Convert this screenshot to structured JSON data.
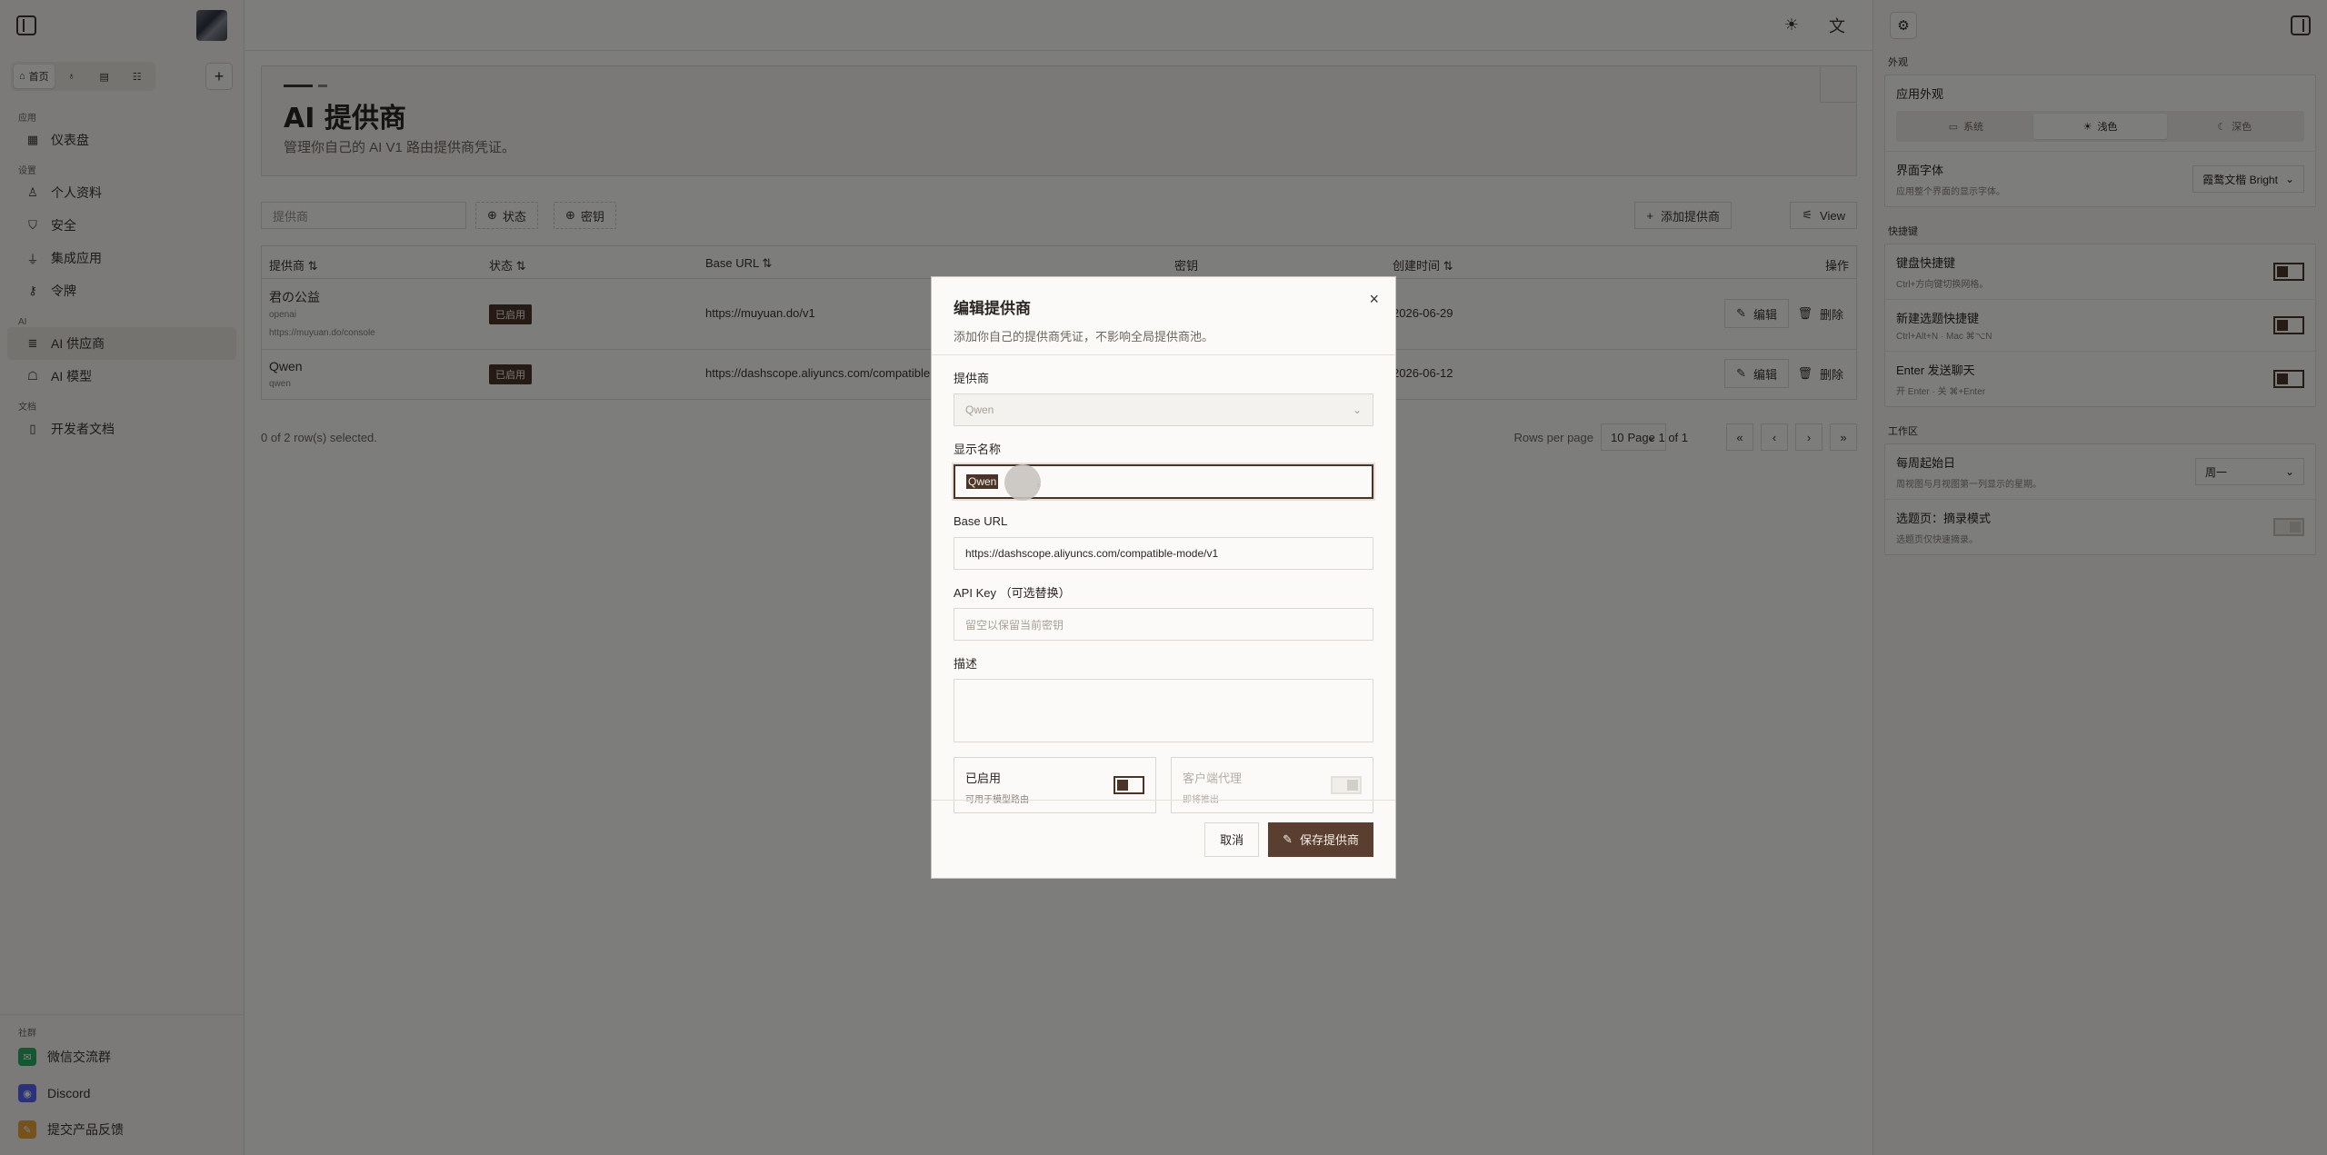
{
  "sidebar": {
    "tabs": [
      {
        "label": "首页",
        "icon": "home-icon"
      },
      {
        "label": "",
        "icon": "lightbulb-icon"
      },
      {
        "label": "",
        "icon": "book-icon"
      },
      {
        "label": "",
        "icon": "chat-icon"
      }
    ],
    "groups": {
      "apps": "应用",
      "settings": "设置",
      "ai": "AI",
      "docs": "文档",
      "community": "社群"
    },
    "items": {
      "dashboard": "仪表盘",
      "profile": "个人资料",
      "security": "安全",
      "integrations": "集成应用",
      "tokens": "令牌",
      "ai_providers": "AI 供应商",
      "ai_models": "AI 模型",
      "dev_docs": "开发者文档"
    },
    "community": {
      "wechat": "微信交流群",
      "discord": "Discord",
      "feedback": "提交产品反馈"
    }
  },
  "page": {
    "title": "AI 提供商",
    "subtitle": "管理你自己的 AI V1 路由提供商凭证。"
  },
  "toolbar": {
    "search_placeholder": "提供商",
    "filter_status": "状态",
    "filter_key": "密钥",
    "add_provider": "添加提供商",
    "view": "View"
  },
  "table": {
    "headers": {
      "provider": "提供商",
      "status": "状态",
      "base_url": "Base URL",
      "key": "密钥",
      "created": "创建时间",
      "actions": "操作"
    },
    "rows": [
      {
        "name": "君の公益",
        "type": "openai",
        "link": "https://muyuan.do/console",
        "status": "已启用",
        "base_url": "https://muyuan.do/v1",
        "created": "2026-06-29",
        "edit": "编辑",
        "delete": "删除"
      },
      {
        "name": "Qwen",
        "type": "qwen",
        "link": "",
        "status": "已启用",
        "base_url": "https://dashscope.aliyuncs.com/compatible",
        "created": "2026-06-12",
        "edit": "编辑",
        "delete": "删除"
      }
    ],
    "selected_text": "0 of 2 row(s) selected.",
    "rows_per_page_label": "Rows per page",
    "rows_per_page": "10",
    "page_info": "Page 1 of 1"
  },
  "rpanel": {
    "appearance_section": "外观",
    "app_appearance": "应用外观",
    "theme_options": [
      {
        "label": "系统",
        "icon": "monitor-icon",
        "active": false
      },
      {
        "label": "浅色",
        "icon": "sun-icon",
        "active": true
      },
      {
        "label": "深色",
        "icon": "moon-icon",
        "active": false
      }
    ],
    "font_title": "界面字体",
    "font_sub": "应用整个界面的显示字体。",
    "font_value": "霞鹜文楷 Bright",
    "shortcuts_section": "快捷键",
    "shortcuts": [
      {
        "title": "键盘快捷键",
        "sub": "Ctrl+方向键切换网格。",
        "on": true
      },
      {
        "title": "新建选题快捷键",
        "sub": "Ctrl+Alt+N · Mac ⌘⌥N",
        "on": true
      },
      {
        "title": "Enter 发送聊天",
        "sub": "开 Enter · 关 ⌘+Enter",
        "on": true
      }
    ],
    "workspace_section": "工作区",
    "week_start_title": "每周起始日",
    "week_start_sub": "周视图与月视图第一列显示的星期。",
    "week_start_value": "周一",
    "capture_title": "选题页：摘录模式",
    "capture_sub": "选题页仅快速摘录。",
    "capture_on": false
  },
  "dialog": {
    "title": "编辑提供商",
    "description": "添加你自己的提供商凭证，不影响全局提供商池。",
    "provider_label": "提供商",
    "provider_value": "Qwen",
    "display_name_label": "显示名称",
    "display_name_value": "Qwen",
    "display_name_suffix": "。",
    "base_url_label": "Base URL",
    "base_url_value": "https://dashscope.aliyuncs.com/compatible-mode/v1",
    "api_key_label": "API Key （可选替换）",
    "api_key_placeholder": "留空以保留当前密钥",
    "description_label": "描述",
    "enabled_title": "已启用",
    "enabled_sub": "可用于模型路由",
    "proxy_title": "客户端代理",
    "proxy_sub": "即将推出",
    "cancel": "取消",
    "save": "保存提供商"
  },
  "colors": {
    "accent": "#5a3e30",
    "badge": "#4a3428",
    "overlay": "rgba(0,0,0,0.5)"
  }
}
